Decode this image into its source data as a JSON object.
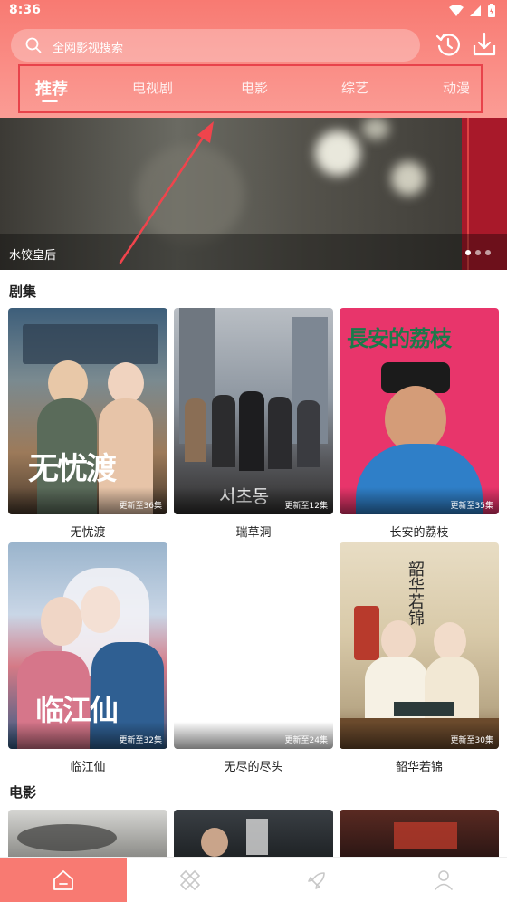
{
  "status_bar": {
    "time": "8:36"
  },
  "search": {
    "placeholder": "全网影视搜索"
  },
  "tabs": [
    {
      "label": "推荐",
      "active": true
    },
    {
      "label": "电视剧",
      "active": false
    },
    {
      "label": "电影",
      "active": false
    },
    {
      "label": "综艺",
      "active": false
    },
    {
      "label": "动漫",
      "active": false
    }
  ],
  "banner": {
    "title": "水饺皇后"
  },
  "sections": {
    "series": {
      "title": "剧集",
      "items": [
        {
          "title": "无忧渡",
          "badge": "更新至36集",
          "poster_text": "无忧渡"
        },
        {
          "title": "瑞草洞",
          "badge": "更新至12集",
          "poster_text": "서초동"
        },
        {
          "title": "长安的荔枝",
          "badge": "更新至35集",
          "poster_text": "長安的荔枝"
        },
        {
          "title": "临江仙",
          "badge": "更新至32集",
          "poster_text": "临江仙"
        },
        {
          "title": "无尽的尽头",
          "badge": "更新至24集",
          "poster_text": ""
        },
        {
          "title": "韶华若锦",
          "badge": "更新至30集",
          "poster_text": "韶华若锦"
        }
      ]
    },
    "movies": {
      "title": "电影"
    }
  },
  "bottom_nav": [
    {
      "icon": "home-icon",
      "active": true
    },
    {
      "icon": "category-icon",
      "active": false
    },
    {
      "icon": "rocket-icon",
      "active": false
    },
    {
      "icon": "profile-icon",
      "active": false
    }
  ],
  "colors": {
    "accent": "#f87a72",
    "highlight_box": "#e8434b"
  }
}
